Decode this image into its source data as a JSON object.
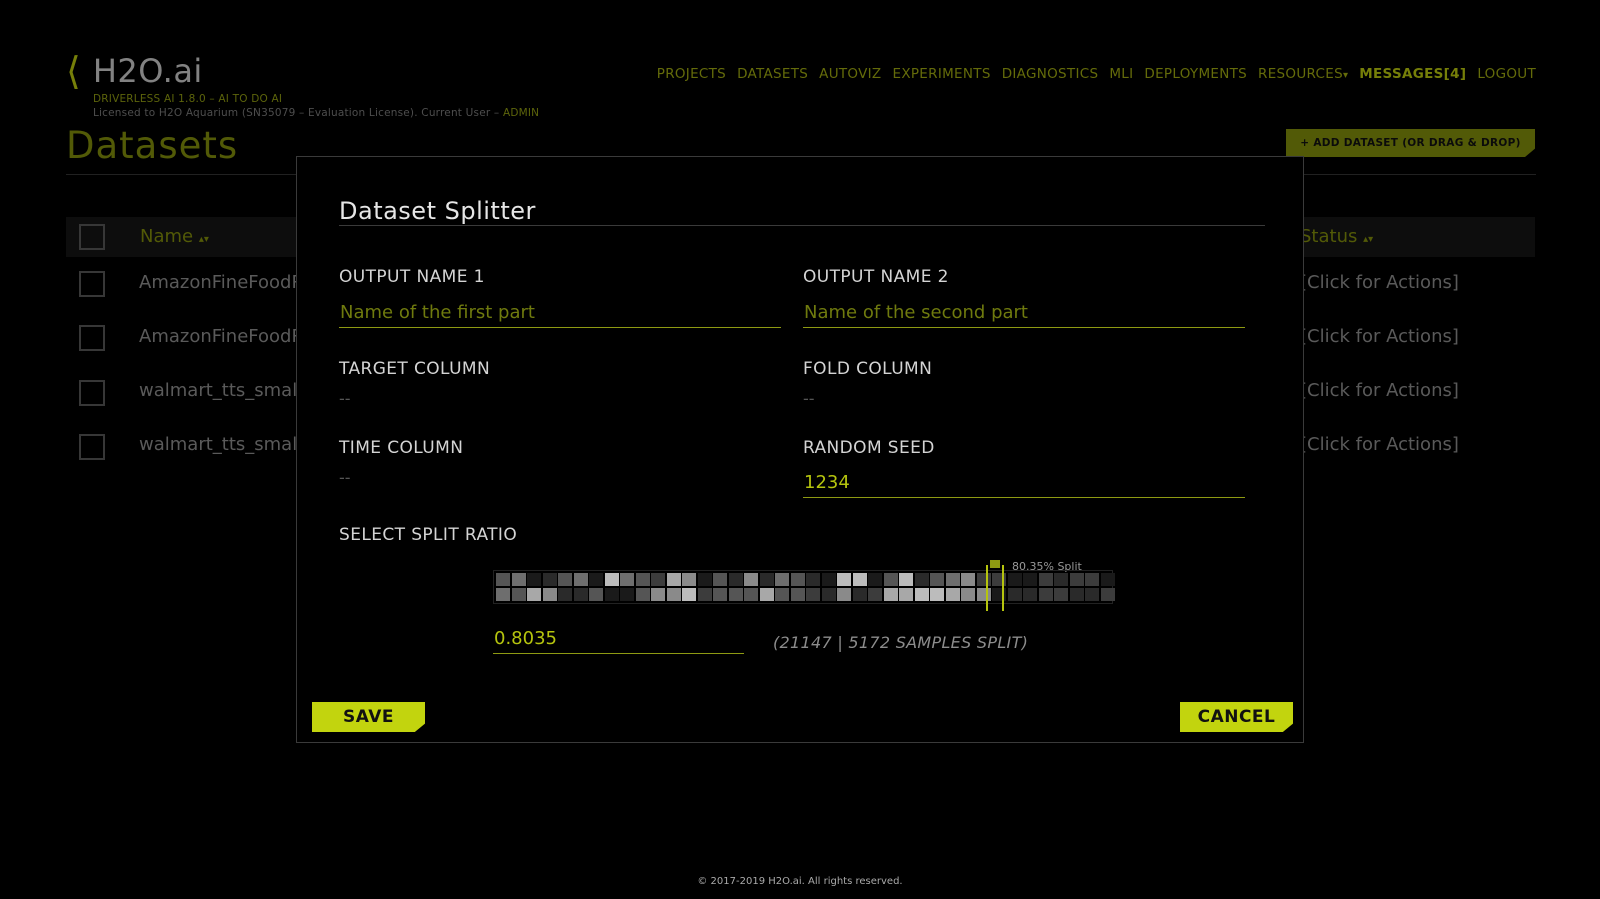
{
  "header": {
    "logo_bracket": "⟨",
    "logo_text": "H2O.ai",
    "subtitle": "DRIVERLESS AI 1.8.0 – AI TO DO AI",
    "license": "Licensed to H2O Aquarium (SN35079 – Evaluation License). Current User – ",
    "user": "ADMIN"
  },
  "nav": {
    "items": [
      "PROJECTS",
      "DATASETS",
      "AUTOVIZ",
      "EXPERIMENTS",
      "DIAGNOSTICS",
      "MLI",
      "DEPLOYMENTS"
    ],
    "resources": "RESOURCES",
    "resources_caret": "▾",
    "messages": "MESSAGES[4]",
    "logout": "LOGOUT"
  },
  "page": {
    "title": "Datasets",
    "add_button": "+ ADD DATASET (OR DRAG & DROP)"
  },
  "table": {
    "col_name": "Name",
    "col_status": "Status",
    "sort_icon": "▴▾",
    "rows": [
      {
        "name": "AmazonFineFoodRe",
        "action": "[Click for Actions]"
      },
      {
        "name": "AmazonFineFoodRe",
        "action": "[Click for Actions]"
      },
      {
        "name": "walmart_tts_small_",
        "action": "[Click for Actions]"
      },
      {
        "name": "walmart_tts_small_",
        "action": "[Click for Actions]"
      }
    ]
  },
  "modal": {
    "title": "Dataset Splitter",
    "output1_label": "OUTPUT NAME 1",
    "output1_placeholder": "Name of the first part",
    "output1_value": "",
    "output2_label": "OUTPUT NAME 2",
    "output2_placeholder": "Name of the second part",
    "output2_value": "",
    "target_label": "TARGET COLUMN",
    "target_value": "--",
    "fold_label": "FOLD COLUMN",
    "fold_value": "--",
    "time_label": "TIME COLUMN",
    "time_value": "--",
    "seed_label": "RANDOM SEED",
    "seed_value": "1234",
    "ratio_label": "SELECT SPLIT RATIO",
    "split_caption": "80.35% Split",
    "split_fraction": 0.8035,
    "ratio_value": "0.8035",
    "samples_text": "(21147 | 5172 SAMPLES SPLIT)",
    "save": "SAVE",
    "cancel": "CANCEL"
  },
  "colors": {
    "accent": "#c2d40e",
    "accent_dim": "#7f8a0c",
    "background": "#000000"
  },
  "footer": "© 2017-2019 H2O.ai. All rights reserved."
}
